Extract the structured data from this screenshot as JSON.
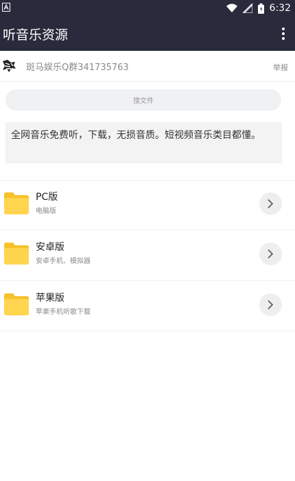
{
  "status_bar": {
    "time": "6:32"
  },
  "app_bar": {
    "title": "听音乐资源"
  },
  "group": {
    "name": "斑马娱乐Q群341735763",
    "report": "举报"
  },
  "search": {
    "placeholder": "搜文件"
  },
  "description": "全网音乐免费听，下载，无损音质。短视频音乐类目都懂。",
  "items": [
    {
      "title": "PC版",
      "subtitle": "电脑版"
    },
    {
      "title": "安卓版",
      "subtitle": "安卓手机、模拟器"
    },
    {
      "title": "苹果版",
      "subtitle": "苹果手机听歌下载"
    }
  ],
  "colors": {
    "app_bar": "#292a3c",
    "folder": "#ffd54f",
    "folder_tab": "#f6c12b"
  },
  "icons": [
    "a-icon",
    "wifi-icon",
    "signal-icon",
    "battery-icon",
    "more-vert-icon",
    "zebra-avatar",
    "folder-icon",
    "chevron-right-icon"
  ]
}
